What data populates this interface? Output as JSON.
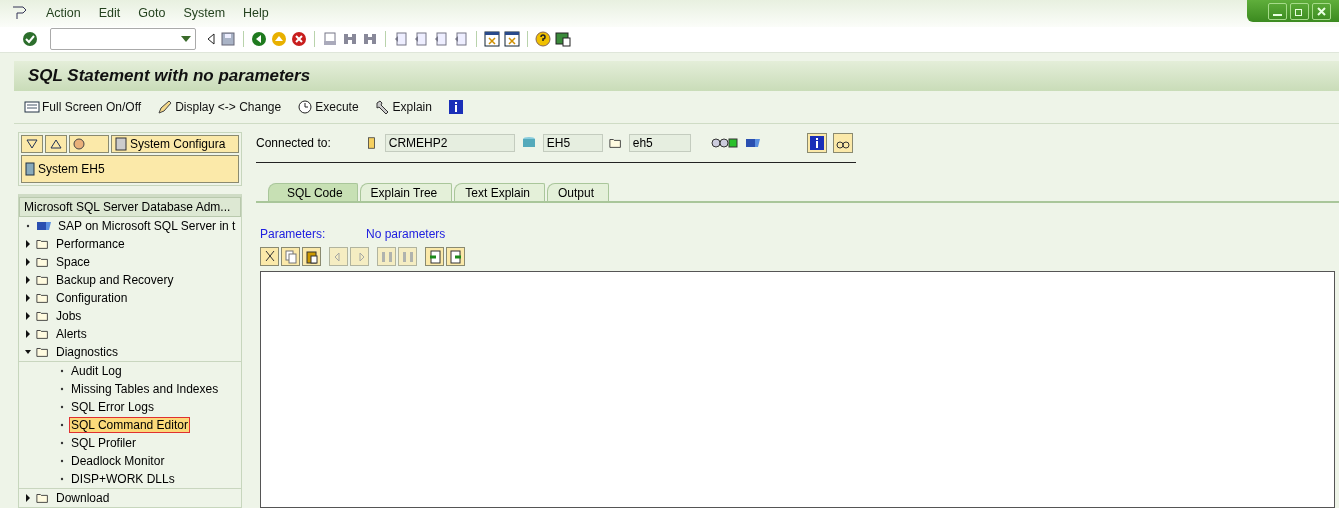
{
  "menu": [
    {
      "label": "Action"
    },
    {
      "label": "Edit"
    },
    {
      "label": "Goto"
    },
    {
      "label": "System"
    },
    {
      "label": "Help"
    }
  ],
  "title": "SQL Statement with no parameters",
  "app_toolbar": [
    {
      "label": "Full Screen On/Off",
      "kind": "screen"
    },
    {
      "label": "Display <-> Change",
      "kind": "pencil"
    },
    {
      "label": "Execute",
      "kind": "clock"
    },
    {
      "label": "Explain",
      "kind": "wrench"
    },
    {
      "kind": "info"
    }
  ],
  "nav": {
    "system_config": "System Configura",
    "system": "System EH5"
  },
  "tree": {
    "header": "Microsoft SQL Server Database Adm...",
    "items": [
      {
        "label": "SAP on Microsoft SQL Server in t",
        "kind": "node",
        "selected": false
      },
      {
        "label": "Performance",
        "kind": "folder",
        "expanded": false,
        "selected": false
      },
      {
        "label": "Space",
        "kind": "folder",
        "expanded": false,
        "selected": false
      },
      {
        "label": "Backup and Recovery",
        "kind": "folder",
        "expanded": false,
        "selected": false
      },
      {
        "label": "Configuration",
        "kind": "folder",
        "expanded": false,
        "selected": false
      },
      {
        "label": "Jobs",
        "kind": "folder",
        "expanded": false,
        "selected": false
      },
      {
        "label": "Alerts",
        "kind": "folder",
        "expanded": false,
        "selected": false
      },
      {
        "label": "Diagnostics",
        "kind": "folder",
        "expanded": true,
        "selected": false,
        "children": [
          {
            "label": "Audit Log",
            "selected": false
          },
          {
            "label": "Missing Tables and Indexes",
            "selected": false
          },
          {
            "label": "SQL Error Logs",
            "selected": false
          },
          {
            "label": "SQL Command Editor",
            "selected": true
          },
          {
            "label": "SQL Profiler",
            "selected": false
          },
          {
            "label": "Deadlock Monitor",
            "selected": false
          },
          {
            "label": "DISP+WORK DLLs",
            "selected": false
          }
        ]
      },
      {
        "label": "Download",
        "kind": "folder",
        "expanded": false,
        "selected": false
      }
    ]
  },
  "connection": {
    "label": "Connected to:",
    "server": "CRMEHP2",
    "database": "EH5",
    "schema": "eh5"
  },
  "tabs": [
    {
      "label": "SQL Code",
      "selected": true
    },
    {
      "label": "Explain Tree",
      "selected": false
    },
    {
      "label": "Text Explain",
      "selected": false
    },
    {
      "label": "Output",
      "selected": false
    }
  ],
  "parameters": {
    "label": "Parameters:",
    "value": "No parameters"
  }
}
